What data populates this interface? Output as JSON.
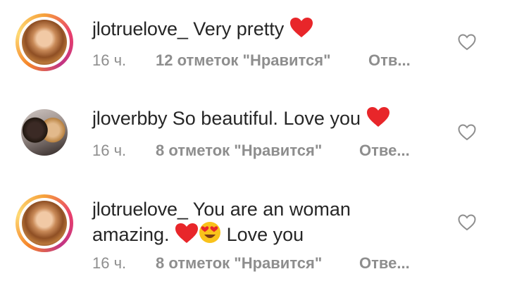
{
  "comments": [
    {
      "username": "jlotruelove_",
      "text": "Very pretty",
      "time": "16 ч.",
      "likes": "12 отметок \"Нравится\"",
      "reply": "Отв..."
    },
    {
      "username": "jloverbby",
      "text": "So beautiful. Love you",
      "time": "16 ч.",
      "likes": "8 отметок \"Нравится\"",
      "reply": "Отве..."
    },
    {
      "username": "jlotruelove_",
      "text_line1": "You are an woman",
      "text_line2a": "amazing.",
      "text_line2b": "Love you",
      "time": "16 ч.",
      "likes": "8 отметок \"Нравится\"",
      "reply": "Отве..."
    }
  ],
  "icons": {
    "heart_emoji": "red-heart-emoji",
    "heart_eyes_emoji": "smiling-face-with-heart-eyes-emoji",
    "like_button": "heart-outline-icon"
  },
  "colors": {
    "text": "#262626",
    "meta": "#8e8e8e",
    "heart": "#e8262a"
  }
}
